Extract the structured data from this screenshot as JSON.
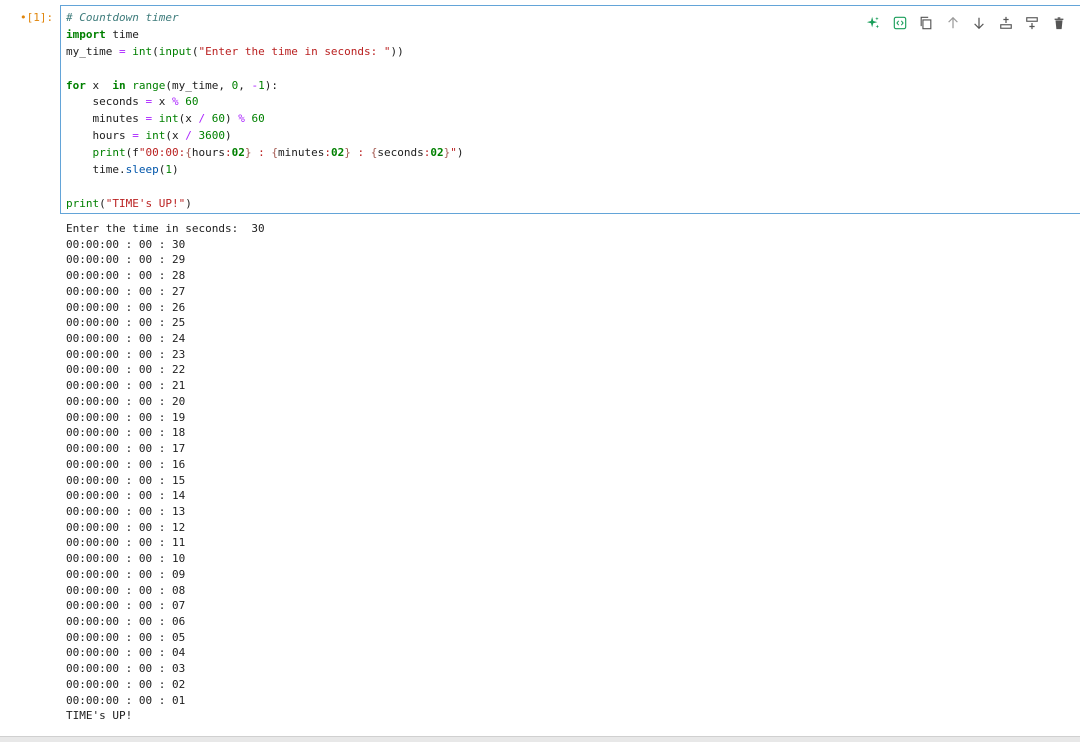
{
  "cell": {
    "prompt_dot": "•",
    "prompt": "[1]:",
    "code_lines": [
      [
        {
          "c": "cm",
          "t": "# Countdown timer"
        }
      ],
      [
        {
          "c": "kw",
          "t": "import"
        },
        {
          "c": "",
          "t": " time"
        }
      ],
      [
        {
          "c": "",
          "t": "my_time "
        },
        {
          "c": "op",
          "t": "="
        },
        {
          "c": "",
          "t": " "
        },
        {
          "c": "bi",
          "t": "int"
        },
        {
          "c": "",
          "t": "("
        },
        {
          "c": "bi",
          "t": "input"
        },
        {
          "c": "",
          "t": "("
        },
        {
          "c": "st",
          "t": "\"Enter the time in seconds: \""
        },
        {
          "c": "",
          "t": "))"
        }
      ],
      [],
      [
        {
          "c": "kw",
          "t": "for"
        },
        {
          "c": "",
          "t": " x  "
        },
        {
          "c": "kw",
          "t": "in"
        },
        {
          "c": "",
          "t": " "
        },
        {
          "c": "bi",
          "t": "range"
        },
        {
          "c": "",
          "t": "(my_time, "
        },
        {
          "c": "nm",
          "t": "0"
        },
        {
          "c": "",
          "t": ", "
        },
        {
          "c": "op",
          "t": "-"
        },
        {
          "c": "nm",
          "t": "1"
        },
        {
          "c": "",
          "t": "):"
        }
      ],
      [
        {
          "c": "",
          "t": "    seconds "
        },
        {
          "c": "op",
          "t": "="
        },
        {
          "c": "",
          "t": " x "
        },
        {
          "c": "op",
          "t": "%"
        },
        {
          "c": "",
          "t": " "
        },
        {
          "c": "nm",
          "t": "60"
        }
      ],
      [
        {
          "c": "",
          "t": "    minutes "
        },
        {
          "c": "op",
          "t": "="
        },
        {
          "c": "",
          "t": " "
        },
        {
          "c": "bi",
          "t": "int"
        },
        {
          "c": "",
          "t": "(x "
        },
        {
          "c": "op",
          "t": "/"
        },
        {
          "c": "",
          "t": " "
        },
        {
          "c": "nm",
          "t": "60"
        },
        {
          "c": "",
          "t": ") "
        },
        {
          "c": "op",
          "t": "%"
        },
        {
          "c": "",
          "t": " "
        },
        {
          "c": "nm",
          "t": "60"
        }
      ],
      [
        {
          "c": "",
          "t": "    hours "
        },
        {
          "c": "op",
          "t": "="
        },
        {
          "c": "",
          "t": " "
        },
        {
          "c": "bi",
          "t": "int"
        },
        {
          "c": "",
          "t": "(x "
        },
        {
          "c": "op",
          "t": "/"
        },
        {
          "c": "",
          "t": " "
        },
        {
          "c": "nm",
          "t": "3600"
        },
        {
          "c": "",
          "t": ")"
        }
      ],
      [
        {
          "c": "",
          "t": "    "
        },
        {
          "c": "bi",
          "t": "print"
        },
        {
          "c": "",
          "t": "(f"
        },
        {
          "c": "st",
          "t": "\"00:00:"
        },
        {
          "c": "br",
          "t": "{"
        },
        {
          "c": "",
          "t": "hours"
        },
        {
          "c": "st",
          "t": ":"
        },
        {
          "c": "fs",
          "t": "02"
        },
        {
          "c": "br",
          "t": "}"
        },
        {
          "c": "st",
          "t": " : "
        },
        {
          "c": "br",
          "t": "{"
        },
        {
          "c": "",
          "t": "minutes"
        },
        {
          "c": "st",
          "t": ":"
        },
        {
          "c": "fs",
          "t": "02"
        },
        {
          "c": "br",
          "t": "}"
        },
        {
          "c": "st",
          "t": " : "
        },
        {
          "c": "br",
          "t": "{"
        },
        {
          "c": "",
          "t": "seconds"
        },
        {
          "c": "st",
          "t": ":"
        },
        {
          "c": "fs",
          "t": "02"
        },
        {
          "c": "br",
          "t": "}"
        },
        {
          "c": "st",
          "t": "\""
        },
        {
          "c": "",
          "t": ")"
        }
      ],
      [
        {
          "c": "",
          "t": "    time"
        },
        {
          "c": "",
          "t": "."
        },
        {
          "c": "at",
          "t": "sleep"
        },
        {
          "c": "",
          "t": "("
        },
        {
          "c": "nm",
          "t": "1"
        },
        {
          "c": "",
          "t": ")"
        }
      ],
      [],
      [
        {
          "c": "bi",
          "t": "print"
        },
        {
          "c": "",
          "t": "("
        },
        {
          "c": "st",
          "t": "\"TIME's UP!\""
        },
        {
          "c": "",
          "t": ")"
        }
      ]
    ]
  },
  "toolbar": [
    {
      "name": "ai-assist-icon",
      "title": "Generate"
    },
    {
      "name": "code-format-icon",
      "title": "Format"
    },
    {
      "name": "duplicate-icon",
      "title": "Duplicate"
    },
    {
      "name": "move-up-icon",
      "title": "Move up"
    },
    {
      "name": "move-down-icon",
      "title": "Move down"
    },
    {
      "name": "insert-above-icon",
      "title": "Insert above"
    },
    {
      "name": "insert-below-icon",
      "title": "Insert below"
    },
    {
      "name": "delete-icon",
      "title": "Delete"
    }
  ],
  "output_lines": [
    "Enter the time in seconds:  30",
    "00:00:00 : 00 : 30",
    "00:00:00 : 00 : 29",
    "00:00:00 : 00 : 28",
    "00:00:00 : 00 : 27",
    "00:00:00 : 00 : 26",
    "00:00:00 : 00 : 25",
    "00:00:00 : 00 : 24",
    "00:00:00 : 00 : 23",
    "00:00:00 : 00 : 22",
    "00:00:00 : 00 : 21",
    "00:00:00 : 00 : 20",
    "00:00:00 : 00 : 19",
    "00:00:00 : 00 : 18",
    "00:00:00 : 00 : 17",
    "00:00:00 : 00 : 16",
    "00:00:00 : 00 : 15",
    "00:00:00 : 00 : 14",
    "00:00:00 : 00 : 13",
    "00:00:00 : 00 : 12",
    "00:00:00 : 00 : 11",
    "00:00:00 : 00 : 10",
    "00:00:00 : 00 : 09",
    "00:00:00 : 00 : 08",
    "00:00:00 : 00 : 07",
    "00:00:00 : 00 : 06",
    "00:00:00 : 00 : 05",
    "00:00:00 : 00 : 04",
    "00:00:00 : 00 : 03",
    "00:00:00 : 00 : 02",
    "00:00:00 : 00 : 01",
    "TIME's UP!"
  ],
  "colors": {
    "editor_border": "#63a4d8",
    "prompt": "#e0850b",
    "ai_icon": "#1a9e5a"
  }
}
